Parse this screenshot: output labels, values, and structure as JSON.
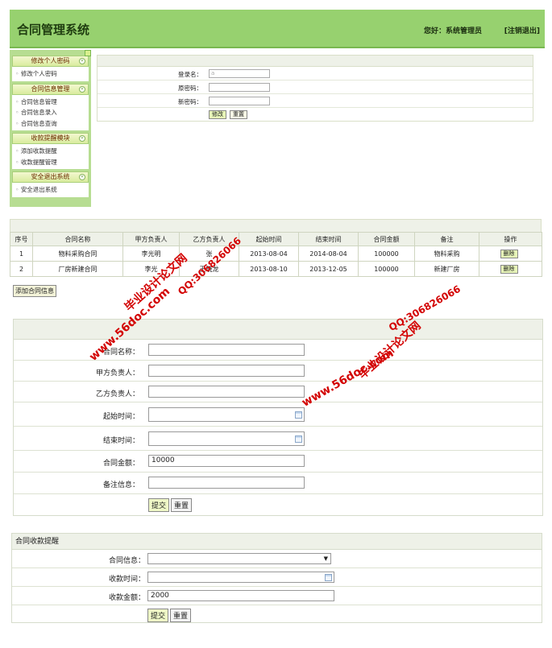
{
  "header": {
    "title": "合同管理系统",
    "welcome": "您好：系统管理员",
    "logout": "[注销退出]"
  },
  "sidebar": {
    "groups": [
      {
        "title": "修改个人密码",
        "items": [
          "修改个人密码"
        ]
      },
      {
        "title": "合同信息管理",
        "items": [
          "合同信息管理",
          "合同信息录入",
          "合同信息查询"
        ]
      },
      {
        "title": "收款提醒模块",
        "items": [
          "添加收款提醒",
          "收款提醒管理"
        ]
      },
      {
        "title": "安全退出系统",
        "items": [
          "安全退出系统"
        ]
      }
    ],
    "toggle_glyph": "«"
  },
  "password_form": {
    "login_label": "登录名：",
    "login_value": "a",
    "old_label": "原密码：",
    "new_label": "新密码：",
    "submit": "修改",
    "reset": "重置"
  },
  "contract_table": {
    "columns": [
      "序号",
      "合同名称",
      "甲方负责人",
      "乙方负责人",
      "起始时间",
      "结束时间",
      "合同金额",
      "备注",
      "操作"
    ],
    "rows": [
      [
        "1",
        "物料采购合同",
        "李光明",
        "张",
        "2013-08-04",
        "2014-08-04",
        "100000",
        "物料采购",
        "删除"
      ],
      [
        "2",
        "厂房新建合同",
        "李光",
        "王晓龙",
        "2013-08-10",
        "2013-12-05",
        "100000",
        "新建厂房",
        "删除"
      ]
    ],
    "add_button": "添加合同信息"
  },
  "contract_form": {
    "name_label": "合同名称：",
    "party_a_label": "甲方负责人：",
    "party_b_label": "乙方负责人：",
    "start_label": "起始时间：",
    "end_label": "结束时间：",
    "amount_label": "合同金额：",
    "amount_value": "10000",
    "note_label": "备注信息：",
    "submit": "提交",
    "reset": "重置"
  },
  "reminder_form": {
    "title": "合同收款提醒",
    "contract_label": "合同信息：",
    "time_label": "收款时间：",
    "amount_label": "收款金额：",
    "amount_value": "2000",
    "submit": "提交",
    "reset": "重置"
  },
  "watermarks": {
    "site1": "www.56doc.com",
    "qq1": "QQ:306826066",
    "brand1": "毕业设计论文网",
    "site2": "www.56doc.com",
    "qq2": "QQ:306826066",
    "brand2": "毕业设计论文网"
  },
  "colors": {
    "header_green": "#97d16f",
    "sidebar_green": "#b7dd92",
    "watermark_red": "#d30000"
  }
}
